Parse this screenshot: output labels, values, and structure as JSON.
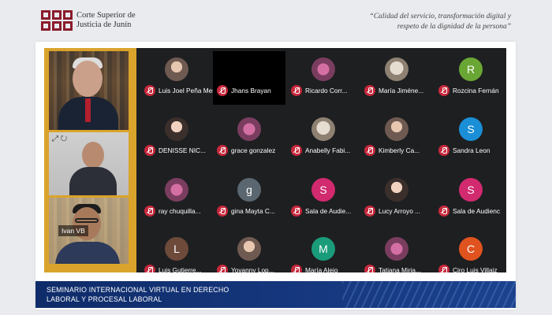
{
  "header": {
    "org_line1": "Corte Superior de",
    "org_line2": "Justicia de Junín",
    "quote_line1": "“Calidad del servicio, transformación digital y",
    "quote_line2": "respeto de la dignidad de la persona”",
    "logo_color": "#8b1c2c"
  },
  "speaker_videos": [
    {
      "name": ""
    },
    {
      "name": "Ivan VB"
    },
    {
      "name": ""
    }
  ],
  "participants": [
    {
      "name": "Luis Joel Peña Mendo",
      "avatar_type": "photo",
      "initial": ""
    },
    {
      "name": "Jhans Brayan",
      "avatar_type": "none",
      "initial": ""
    },
    {
      "name": "Ricardo Corr...",
      "avatar_type": "photo",
      "initial": ""
    },
    {
      "name": "María Jiméne...",
      "avatar_type": "photo",
      "initial": ""
    },
    {
      "name": "Rozcina Fernán",
      "avatar_type": "initial",
      "initial": "R",
      "color": "#6aa634"
    },
    {
      "name": "DENISSE NIC...",
      "avatar_type": "photo",
      "initial": ""
    },
    {
      "name": "grace gonzalez",
      "avatar_type": "photo",
      "initial": ""
    },
    {
      "name": "Anabelly Fabi...",
      "avatar_type": "photo",
      "initial": ""
    },
    {
      "name": "Kimberly Ca...",
      "avatar_type": "photo",
      "initial": ""
    },
    {
      "name": "Sandra Leon",
      "avatar_type": "initial",
      "initial": "S",
      "color": "#1a8ed6"
    },
    {
      "name": "ray chuquilla...",
      "avatar_type": "photo",
      "initial": ""
    },
    {
      "name": "gina Mayta C...",
      "avatar_type": "initial",
      "initial": "g",
      "color": "#5b6770"
    },
    {
      "name": "Sala de Audie...",
      "avatar_type": "initial",
      "initial": "S",
      "color": "#d12a6e"
    },
    {
      "name": "Lucy Arroyo ...",
      "avatar_type": "photo",
      "initial": ""
    },
    {
      "name": "Sala de Audienc",
      "avatar_type": "initial",
      "initial": "S",
      "color": "#d12a6e"
    },
    {
      "name": "Luis Gutierre...",
      "avatar_type": "initial",
      "initial": "L",
      "color": "#6d4a3a"
    },
    {
      "name": "Yovanny Lop...",
      "avatar_type": "photo",
      "initial": ""
    },
    {
      "name": "María Alejo",
      "avatar_type": "initial",
      "initial": "M",
      "color": "#1a9c7a"
    },
    {
      "name": "Tatiana Miria...",
      "avatar_type": "photo",
      "initial": ""
    },
    {
      "name": "Ciro Luis Villaiz",
      "avatar_type": "initial",
      "initial": "C",
      "color": "#e0531f"
    }
  ],
  "banner": {
    "line1": "SEMINARIO INTERNACIONAL VIRTUAL EN DERECHO",
    "line2": "LABORAL Y PROCESAL LABORAL"
  }
}
